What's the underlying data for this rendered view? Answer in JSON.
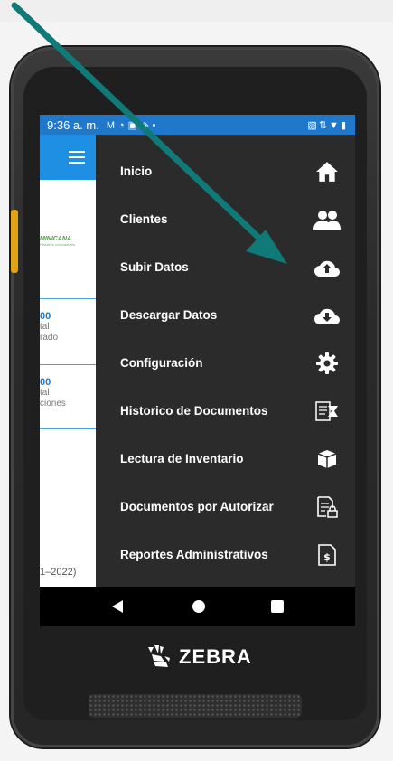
{
  "status_bar": {
    "time": "9:36 a. m.",
    "left_icons": [
      "gmail-icon",
      "sync-icon",
      "tv-icon",
      "code-icon",
      "dot-icon"
    ],
    "right_icons": [
      "cast-icon",
      "data-icon",
      "wifi-icon",
      "battery-icon"
    ]
  },
  "app": {
    "brand_name": "MINICANA",
    "brand_sub": "Plásticos Innovadores",
    "cards": [
      {
        "value": "00",
        "label_line1": "tal",
        "label_line2": "rado"
      },
      {
        "value": "00",
        "label_line1": "tal",
        "label_line2": "ciones"
      }
    ],
    "footer_text": "1–2022)"
  },
  "drawer": {
    "items": [
      {
        "label": "Inicio",
        "icon": "home-icon"
      },
      {
        "label": "Clientes",
        "icon": "people-icon"
      },
      {
        "label": "Subir Datos",
        "icon": "cloud-upload-icon"
      },
      {
        "label": "Descargar Datos",
        "icon": "cloud-download-icon"
      },
      {
        "label": "Configuración",
        "icon": "gear-icon"
      },
      {
        "label": "Historico de Documentos",
        "icon": "document-history-icon"
      },
      {
        "label": "Lectura de Inventario",
        "icon": "box-icon"
      },
      {
        "label": "Documentos por Autorizar",
        "icon": "document-lock-icon"
      },
      {
        "label": "Reportes Administrativos",
        "icon": "dollar-document-icon"
      }
    ]
  },
  "device": {
    "brand": "ZEBRA"
  },
  "colors": {
    "status_bar": "#1f78c9",
    "app_header": "#1f8fe3",
    "drawer_bg": "#2b2b2b",
    "arrow": "#0f7a78",
    "side_button": "#e0a316"
  }
}
